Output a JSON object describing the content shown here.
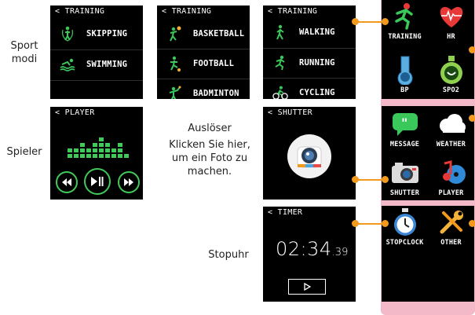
{
  "training_screens": [
    {
      "header": "< TRAINING",
      "items": [
        {
          "icon": "skipping-icon",
          "label": "SKIPPING"
        },
        {
          "icon": "swimming-icon",
          "label": "SWIMMING"
        }
      ]
    },
    {
      "header": "< TRAINING",
      "items": [
        {
          "icon": "basketball-icon",
          "label": "BASKETBALL"
        },
        {
          "icon": "football-icon",
          "label": "FOOTBALL"
        },
        {
          "icon": "badminton-icon",
          "label": "BADMINTON"
        }
      ]
    },
    {
      "header": "< TRAINING",
      "items": [
        {
          "icon": "walking-icon",
          "label": "WALKING"
        },
        {
          "icon": "running-icon",
          "label": "RUNNING"
        },
        {
          "icon": "cycling-icon",
          "label": "CYCLING"
        }
      ]
    }
  ],
  "player_screen": {
    "header": "< PLAYER",
    "buttons": [
      "rewind-icon",
      "play-pause-icon",
      "fast-forward-icon"
    ]
  },
  "shutter_screen": {
    "header": "< SHUTTER",
    "icon": "camera-icon"
  },
  "timer_screen": {
    "header": "< TIMER",
    "time_main": "02:34",
    "time_fraction": ".39",
    "button_icon": "play-icon"
  },
  "captions": {
    "sport_modes_1": "Sport",
    "sport_modes_2": "modi",
    "player": "Spieler",
    "shutter_1": "Auslöser",
    "shutter_2": "Klicken Sie hier,",
    "shutter_3": "um ein Foto zu",
    "shutter_4": "machen.",
    "stopwatch": "Stopuhr"
  },
  "app_menu": [
    {
      "label": "TRAINING",
      "icon": "runner-icon"
    },
    {
      "label": "HR",
      "icon": "heart-rate-icon"
    },
    {
      "label": "BP",
      "icon": "thermometer-icon"
    },
    {
      "label": "SPO2",
      "icon": "oxygen-flask-icon"
    },
    {
      "label": "MESSAGE",
      "icon": "message-icon"
    },
    {
      "label": "WEATHER",
      "icon": "cloud-icon"
    },
    {
      "label": "SHUTTER",
      "icon": "camera-icon"
    },
    {
      "label": "PLAYER",
      "icon": "music-icon"
    },
    {
      "label": "STOPCLOCK",
      "icon": "stopwatch-icon"
    },
    {
      "label": "OTHER",
      "icon": "tools-icon"
    }
  ],
  "colors": {
    "accent": "#f39a1e",
    "pink": "#f4b9c8",
    "eq_green": "#41c95a"
  }
}
